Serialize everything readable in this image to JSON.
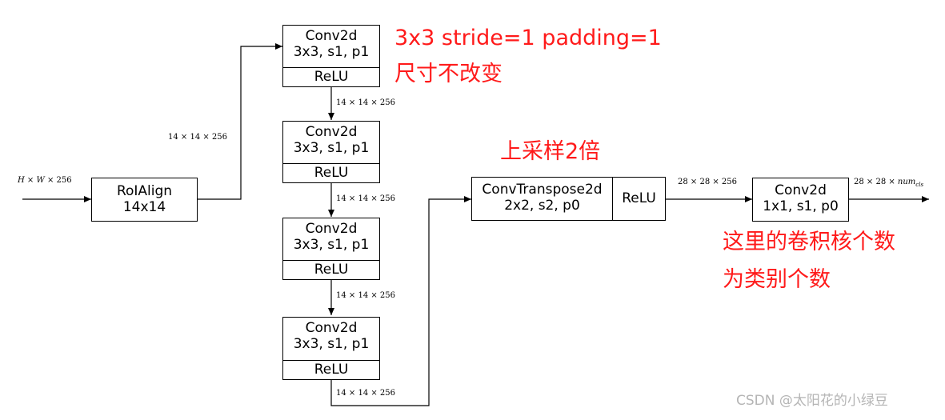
{
  "colors": {
    "stroke": "#000000",
    "annotation": "#ff1a1a",
    "watermark": "#b5b5b5"
  },
  "input_label": {
    "pre": "H",
    "mid1": " × ",
    "w": "W",
    "mid2": " × 256"
  },
  "roialign": {
    "line1": "RoIAlign",
    "line2": "14x14"
  },
  "label_14_256": "14 × 14 × 256",
  "conv_blocks": [
    {
      "line1": "Conv2d",
      "line2": "3x3, s1, p1",
      "act": "ReLU"
    },
    {
      "line1": "Conv2d",
      "line2": "3x3, s1, p1",
      "act": "ReLU"
    },
    {
      "line1": "Conv2d",
      "line2": "3x3, s1, p1",
      "act": "ReLU"
    },
    {
      "line1": "Conv2d",
      "line2": "3x3, s1, p1",
      "act": "ReLU"
    }
  ],
  "deconv": {
    "line1": "ConvTranspose2d",
    "line2": "2x2, s2, p0",
    "act": "ReLU"
  },
  "label_28_256": "28 × 28 × 256",
  "final_conv": {
    "line1": "Conv2d",
    "line2": "1x1, s1, p0"
  },
  "output_label": {
    "pre": "28 × 28 × ",
    "num": "num",
    "sub": "cls"
  },
  "annotations": {
    "conv_note_line1": "3x3 stride=1 padding=1",
    "conv_note_line2": "尺寸不改变",
    "upsample_note": "上采样2倍",
    "cls_note_line1": "这里的卷积核个数",
    "cls_note_line2": "为类别个数"
  },
  "watermark": "CSDN @太阳花的小绿豆"
}
